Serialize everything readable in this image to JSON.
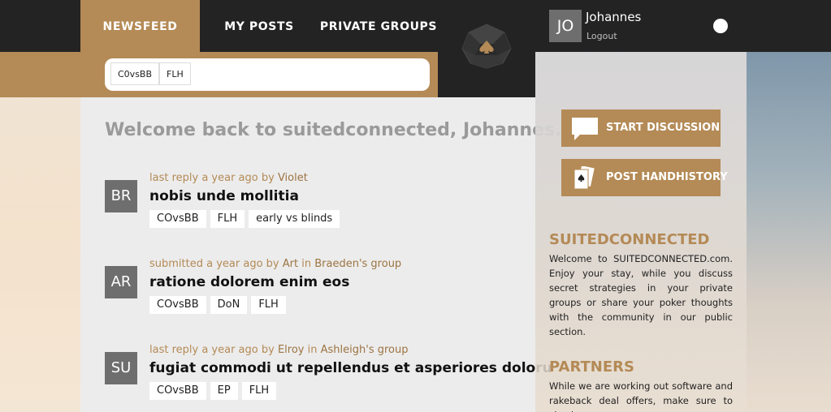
{
  "nav": {
    "tabs": [
      {
        "label": "NEWSFEED",
        "active": true
      },
      {
        "label": "MY POSTS",
        "active": false
      },
      {
        "label": "PRIVATE GROUPS",
        "active": false
      }
    ]
  },
  "filter_tags": [
    "C0vsBB",
    "FLH"
  ],
  "user": {
    "initials": "JO",
    "name": "Johannes",
    "logout_label": "Logout"
  },
  "colors": {
    "accent": "#b48a56",
    "dark": "#232323"
  },
  "welcome": "Welcome back to suitedconnected, Johannes.",
  "posts": [
    {
      "initials": "BR",
      "meta_prefix": "last reply a year ago by",
      "author": "Violet",
      "group_prefix": "",
      "group": "",
      "title": "nobis unde mollitia",
      "tags": [
        "COvsBB",
        "FLH",
        "early vs blinds"
      ]
    },
    {
      "initials": "AR",
      "meta_prefix": "submitted a year ago by",
      "author": "Art",
      "group_prefix": "in",
      "group": "Braeden's group",
      "title": "ratione dolorem enim eos",
      "tags": [
        "COvsBB",
        "DoN",
        "FLH"
      ]
    },
    {
      "initials": "SU",
      "meta_prefix": "last reply a year ago by",
      "author": "Elroy",
      "group_prefix": "in",
      "group": "Ashleigh's group",
      "title": "fugiat commodi ut repellendus et asperiores doloru",
      "tags": [
        "COvsBB",
        "EP",
        "FLH"
      ]
    }
  ],
  "sidebar": {
    "start_discussion": "START DISCUSSION",
    "post_handhistory": "POST HANDHISTORY",
    "about_heading": "SUITEDCONNECTED",
    "about_text": "Welcome to SUITEDCONNECTED.com. Enjoy your stay, while you discuss secret strategies in your private groups or share your poker thoughts with the community in our public section.",
    "partners_heading": "PARTNERS",
    "partners_text": "While we are working out software and rakeback deal offers, make sure to check"
  }
}
